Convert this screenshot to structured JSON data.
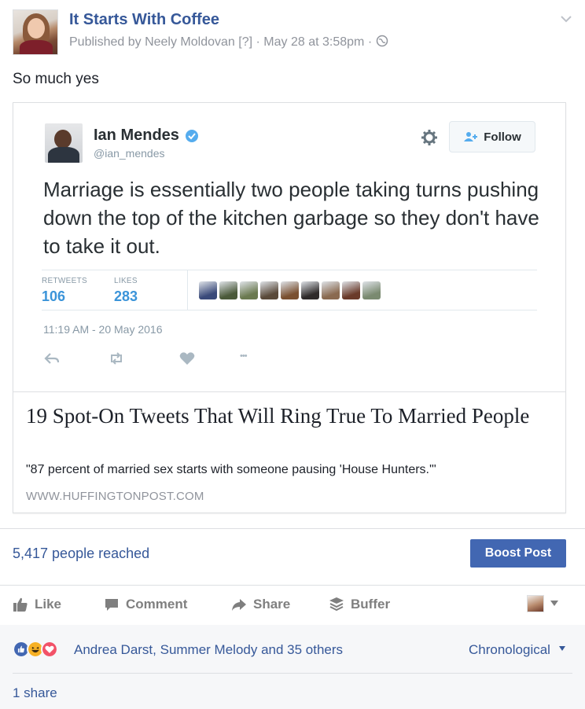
{
  "post": {
    "page_name": "It Starts With Coffee",
    "publisher": "Published by Neely Moldovan",
    "help_marker": "[?]",
    "timestamp": "May 28 at 3:58pm",
    "separator": "·",
    "text": "So much yes"
  },
  "tweet": {
    "name": "Ian Mendes",
    "handle": "@ian_mendes",
    "follow_label": "Follow",
    "text": "Marriage is essentially two people taking turns pushing down the top of the kitchen garbage so they don't have to take it out.",
    "retweets_label": "RETWEETS",
    "retweets": "106",
    "likes_label": "LIKES",
    "likes": "283",
    "date": "11:19 AM - 20 May 2016",
    "more": "•••",
    "liker_colors": [
      "#3a4a7a",
      "#4b5a3a",
      "#6b7a50",
      "#5a4a3a",
      "#7a5030",
      "#2e2a2a",
      "#8a6a50",
      "#6a3a2a",
      "#7a8a70"
    ]
  },
  "link_card": {
    "title": "19 Spot-On Tweets That Will Ring True To Married People",
    "description": "\"87 percent of married sex starts with someone pausing 'House Hunters.'\"",
    "domain": "WWW.HUFFINGTONPOST.COM"
  },
  "insights": {
    "reach": "5,417 people reached",
    "boost_label": "Boost Post"
  },
  "actions": {
    "like": "Like",
    "comment": "Comment",
    "share": "Share",
    "buffer": "Buffer"
  },
  "footer": {
    "reaction_names": "Andrea Darst, Summer Melody and 35 others",
    "sort_label": "Chronological",
    "shares": "1 share"
  },
  "colors": {
    "link_blue": "#365899",
    "boost_blue": "#4267b2",
    "twitter_blue": "#3b94d9",
    "muted": "#90949c"
  }
}
